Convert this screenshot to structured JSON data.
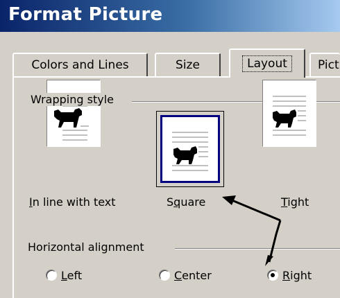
{
  "window": {
    "title": "Format Picture"
  },
  "tabs": [
    {
      "label": "Colors and Lines",
      "active": false
    },
    {
      "label": "Size",
      "active": false
    },
    {
      "label": "Layout",
      "active": true
    },
    {
      "label": "Pict",
      "active": false
    }
  ],
  "wrapping": {
    "group_label": "Wrapping style",
    "options": [
      {
        "label": "In line with text",
        "mnemonic": "I",
        "rest": "n line with text",
        "icon": "dog-icon",
        "selected": false
      },
      {
        "label": "Square",
        "pre": "S",
        "mnemonic": "q",
        "rest": "uare",
        "icon": "dog-icon",
        "selected": true
      },
      {
        "label": "Tight",
        "mnemonic": "T",
        "rest": "ight",
        "icon": "dog-icon",
        "selected": false
      }
    ]
  },
  "alignment": {
    "group_label": "Horizontal alignment",
    "options": [
      {
        "label": "Left",
        "mnemonic": "L",
        "rest": "eft",
        "checked": false
      },
      {
        "label": "Center",
        "mnemonic": "C",
        "rest": "enter",
        "checked": false
      },
      {
        "label": "Right",
        "mnemonic": "R",
        "rest": "ight",
        "checked": true
      }
    ]
  },
  "colors": {
    "title_start": "#0a246a",
    "title_end": "#a6caf0",
    "selection": "#000080",
    "face": "#d4d0c8"
  }
}
